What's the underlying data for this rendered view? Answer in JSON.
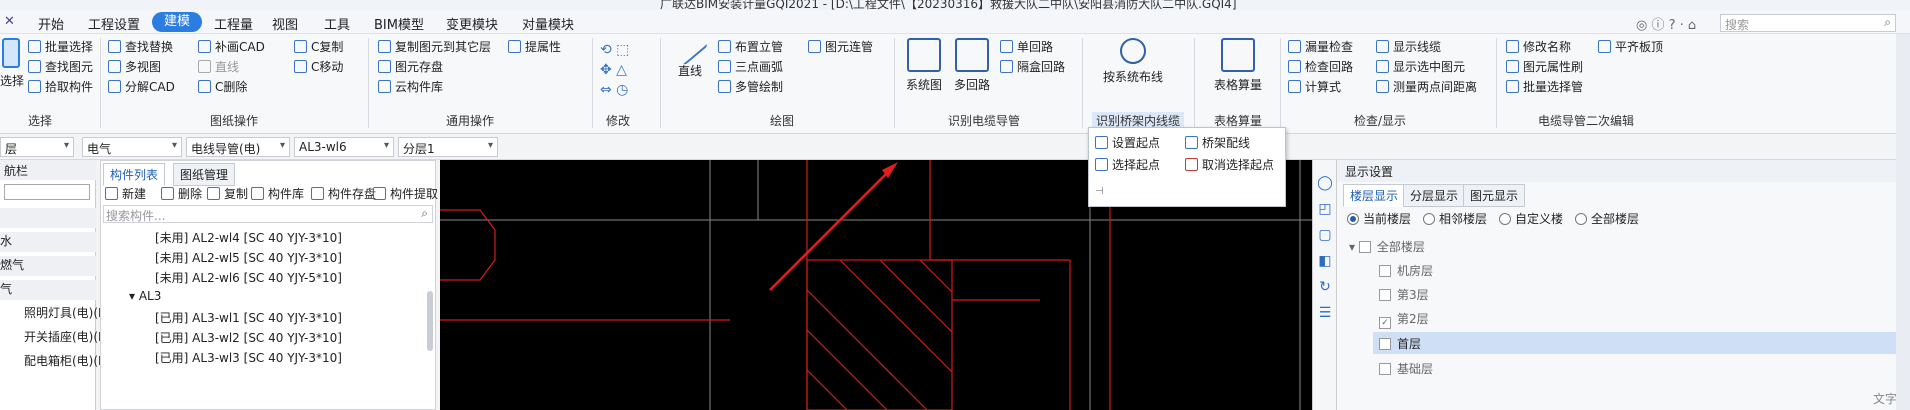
{
  "title": "广联达BIM安装计量GQI2021 - [D:\\工程文件\\【20230316】救援大队二中队\\安阳县消防大队二中队.GQI4]",
  "menu": [
    "开始",
    "工程设置",
    "建模",
    "工程量",
    "视图",
    "工具",
    "BIM模型",
    "变更模块",
    "对量模块"
  ],
  "menu_active": "建模",
  "search_placeholder": "搜索",
  "ribbon": {
    "select_group": {
      "big": "选择",
      "items": [
        "批量选择",
        "查找图元",
        "拾取构件"
      ],
      "label": "选择"
    },
    "drawing_ops": {
      "items": [
        "查找替换",
        "补画CAD",
        "C复制",
        "多视图",
        "直线",
        "C移动",
        "分解CAD",
        "C删除"
      ],
      "label": "图纸操作"
    },
    "general_ops": {
      "items": [
        "复制图元到其它层",
        "提属性",
        "图元存盘",
        "云构件库"
      ],
      "label": "通用操作"
    },
    "modify": {
      "label": "修改"
    },
    "draw": {
      "big": "直线",
      "items": [
        "布置立管",
        "图元连管",
        "三点画弧",
        "多管绘制"
      ],
      "label": "绘图"
    },
    "identify_cable": {
      "bigs": [
        "系统图",
        "多回路"
      ],
      "items": [
        "单回路",
        "隔盒回路"
      ],
      "label": "识别电缆导管"
    },
    "identify_tray": {
      "big": "按系统布线",
      "label": "识别桥架内线缆"
    },
    "table_calc": {
      "big": "表格算量",
      "label": "表格算量"
    },
    "check_display": {
      "items": [
        "漏量检查",
        "显示线缆",
        "检查回路",
        "显示选中图元",
        "计算式",
        "测量两点间距离"
      ],
      "label": "检查/显示"
    },
    "cable_edit2": {
      "items": [
        "修改名称",
        "平齐板顶",
        "图元属性刷",
        "批量选择管"
      ],
      "label": "电缆导管二次编辑"
    }
  },
  "filters": [
    "层",
    "电气",
    "电线导管(电)",
    "AL3-wl6",
    "分层1"
  ],
  "left_nav": {
    "title": "航栏",
    "items": [
      "",
      "水",
      "燃气",
      "气",
      "照明灯具(电)(D",
      "开关插座(电)(K",
      "配电箱柜(电)(P"
    ]
  },
  "comp_panel": {
    "tabs": [
      "构件列表",
      "图纸管理"
    ],
    "actions": [
      "新建",
      "删除",
      "复制",
      "构件库",
      "构件存盘",
      "构件提取"
    ],
    "search_placeholder": "搜索构件...",
    "rows": [
      "[未用] AL2-wl4 [SC 40 YJY-3*10]",
      "[未用] AL2-wl5 [SC 40 YJY-3*10]",
      "[未用] AL2-wl6 [SC 40 YJY-5*10]",
      "AL3",
      "[已用] AL3-wl1 [SC 40 YJY-3*10]",
      "[已用] AL3-wl2 [SC 40 YJY-3*10]",
      "[已用] AL3-wl3 [SC 40 YJY-3*10]"
    ]
  },
  "popup": {
    "items": [
      "设置起点",
      "桥架配线",
      "选择起点",
      "取消选择起点"
    ]
  },
  "display": {
    "title": "显示设置",
    "tabs": [
      "楼层显示",
      "分层显示",
      "图元显示"
    ],
    "radios": [
      "当前楼层",
      "相邻楼层",
      "自定义楼",
      "全部楼层"
    ],
    "floors": [
      "全部楼层",
      "机房层",
      "第3层",
      "第2层",
      "首层",
      "基础层"
    ],
    "checked": "第2层",
    "selected": "首层",
    "side_text": "文字"
  },
  "colors": {
    "accent": "#2b7de0",
    "canvas": "#000000",
    "line": "#e0201e",
    "arrow": "#e02020"
  }
}
